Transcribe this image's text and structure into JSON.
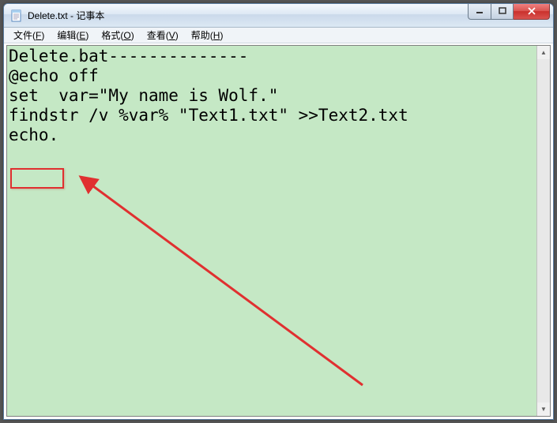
{
  "window": {
    "title": "Delete.txt - 记事本"
  },
  "menu": {
    "file": {
      "label": "文件",
      "accel": "F"
    },
    "edit": {
      "label": "编辑",
      "accel": "E"
    },
    "format": {
      "label": "格式",
      "accel": "O"
    },
    "view": {
      "label": "查看",
      "accel": "V"
    },
    "help": {
      "label": "帮助",
      "accel": "H"
    }
  },
  "content": {
    "lines": [
      "Delete.bat--------------",
      "@echo off",
      "set  var=\"My name is Wolf.\"",
      "findstr /v %var% \"Text1.txt\" >>Text2.txt",
      "echo."
    ]
  },
  "annotation": {
    "highlight_line_index": 4,
    "highlight_text": "echo."
  }
}
